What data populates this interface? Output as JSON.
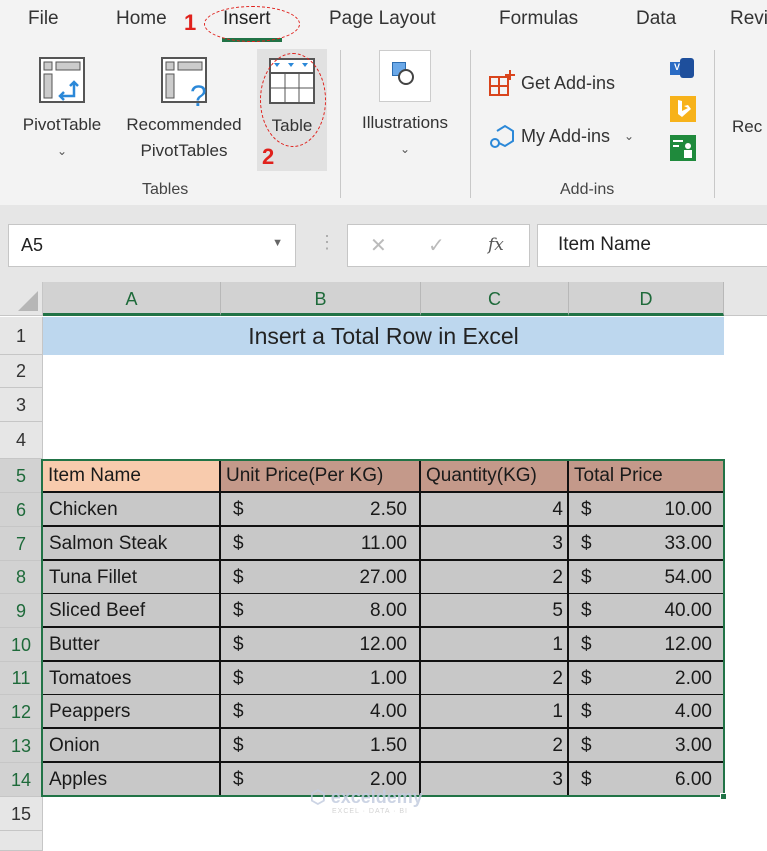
{
  "ribbon": {
    "tabs": [
      {
        "label": "File"
      },
      {
        "label": "Home"
      },
      {
        "label": "Insert",
        "active": true
      },
      {
        "label": "Page Layout"
      },
      {
        "label": "Formulas"
      },
      {
        "label": "Data"
      },
      {
        "label": "Revi"
      }
    ],
    "annotations": {
      "step1": "1",
      "step2": "2"
    },
    "groups": {
      "tables": {
        "label": "Tables",
        "pivottable": "PivotTable",
        "recommended_line1": "Recommended",
        "recommended_line2": "PivotTables",
        "table": "Table"
      },
      "illustrations": {
        "label": "Illustrations"
      },
      "addins": {
        "label": "Add-ins",
        "get_addins": "Get Add-ins",
        "my_addins": "My Add-ins"
      },
      "recommended_charts_partial": "Rec"
    },
    "colors": {
      "accent": "#217346",
      "annotation": "#e0211c"
    }
  },
  "formula_bar": {
    "name_box": "A5",
    "cancel_icon": "✕",
    "enter_icon": "✓",
    "fx_label": "fx",
    "content": "Item Name"
  },
  "sheet": {
    "columns": [
      "A",
      "B",
      "C",
      "D"
    ],
    "rows": [
      "1",
      "2",
      "3",
      "4",
      "5",
      "6",
      "7",
      "8",
      "9",
      "10",
      "11",
      "12",
      "13",
      "14",
      "15"
    ],
    "title": "Insert a Total Row in Excel",
    "table": {
      "headers": [
        "Item Name",
        "Unit Price(Per KG)",
        "Quantity(KG)",
        "Total Price"
      ],
      "currency": "$",
      "rows": [
        {
          "item": "Chicken",
          "unit_price": "2.50",
          "qty": "4",
          "total": "10.00"
        },
        {
          "item": "Salmon Steak",
          "unit_price": "11.00",
          "qty": "3",
          "total": "33.00"
        },
        {
          "item": "Tuna Fillet",
          "unit_price": "27.00",
          "qty": "2",
          "total": "54.00"
        },
        {
          "item": "Sliced Beef",
          "unit_price": "8.00",
          "qty": "5",
          "total": "40.00"
        },
        {
          "item": "Butter",
          "unit_price": "12.00",
          "qty": "1",
          "total": "12.00"
        },
        {
          "item": "Tomatoes",
          "unit_price": "1.00",
          "qty": "2",
          "total": "2.00"
        },
        {
          "item": "Peappers",
          "unit_price": "4.00",
          "qty": "1",
          "total": "4.00"
        },
        {
          "item": "Onion",
          "unit_price": "1.50",
          "qty": "2",
          "total": "3.00"
        },
        {
          "item": "Apples",
          "unit_price": "2.00",
          "qty": "3",
          "total": "6.00"
        }
      ]
    },
    "watermark": {
      "brand": "exceldemy",
      "tagline": "EXCEL · DATA · BI"
    }
  }
}
